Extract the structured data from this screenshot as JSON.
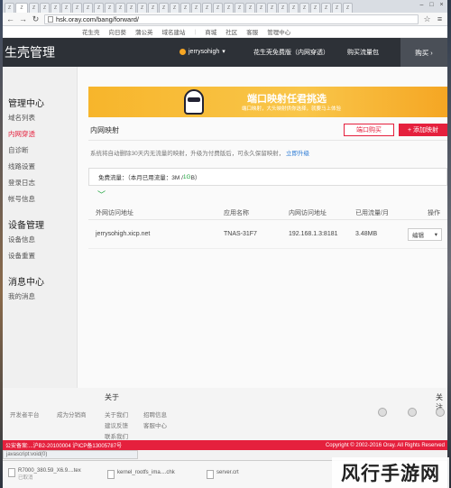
{
  "browser": {
    "url": "hsk.oray.com/bang/forward/",
    "tab_glyph": "Z"
  },
  "toplinks": [
    "花生壳",
    "向日葵",
    "蒲公英",
    "域名建站",
    "商城",
    "社区",
    "客服",
    "管理中心"
  ],
  "header": {
    "brand": "生壳管理",
    "username": "jerrysohigh",
    "edition": "花生壳免费版（内网穿透）",
    "buy_traffic": "购买流量包",
    "buy": "购买"
  },
  "sidebar": {
    "sections": [
      {
        "title": "管理中心",
        "items": [
          "域名列表",
          "内网穿透",
          "自诊断",
          "线路设置",
          "登录日志",
          "帐号信息"
        ]
      },
      {
        "title": "设备管理",
        "items": [
          "设备信息",
          "设备重置"
        ]
      },
      {
        "title": "消息中心",
        "items": [
          "我的消息"
        ]
      }
    ],
    "active_item": "内网穿透"
  },
  "banner": {
    "title": "端口映射任君挑选",
    "subtitle": "端口映射，大头映射供你选择，就要马上体验"
  },
  "panel": {
    "title": "内网映射",
    "btn_port": "端口购买",
    "btn_add": "+ 添加映射",
    "notice": "系统将自动删除30天内无流量的映射，升级为付费版后，可永久保留映射",
    "notice_link": "立即升级"
  },
  "quota": {
    "label": "免费流量：（本月已用流量：3M / ",
    "value": "1G",
    "suffix": "B）"
  },
  "table": {
    "headers": [
      "外网访问地址",
      "应用名称",
      "内网访问地址",
      "已用流量/月",
      "操作"
    ],
    "rows": [
      {
        "domain": "jerrysohigh.xicp.net",
        "app": "TNAS-31F7",
        "internal": "192.168.1.3:8181",
        "traffic": "3.48MB",
        "action": "编辑"
      }
    ]
  },
  "footer": {
    "about": "关于",
    "follow": "关注",
    "links": [
      "开发者平台",
      "成为分销商",
      "关于我们",
      "建议反馈",
      "联系我们",
      "招聘信息",
      "客服中心"
    ],
    "icp": "公安备案:...沪B2-20100004 沪ICP备13005787号",
    "copyright": "Copyright © 2002-2016 Oray. All Rights Reserved"
  },
  "statusbar": "javascript:void(0)",
  "downloads": [
    {
      "name": "R7000_380.59_X6.9....tex",
      "sub": "已取消"
    },
    {
      "name": "kernel_rootfs_ima....chk",
      "sub": ""
    },
    {
      "name": "server.crt",
      "sub": ""
    }
  ],
  "watermark": "风行手游网"
}
